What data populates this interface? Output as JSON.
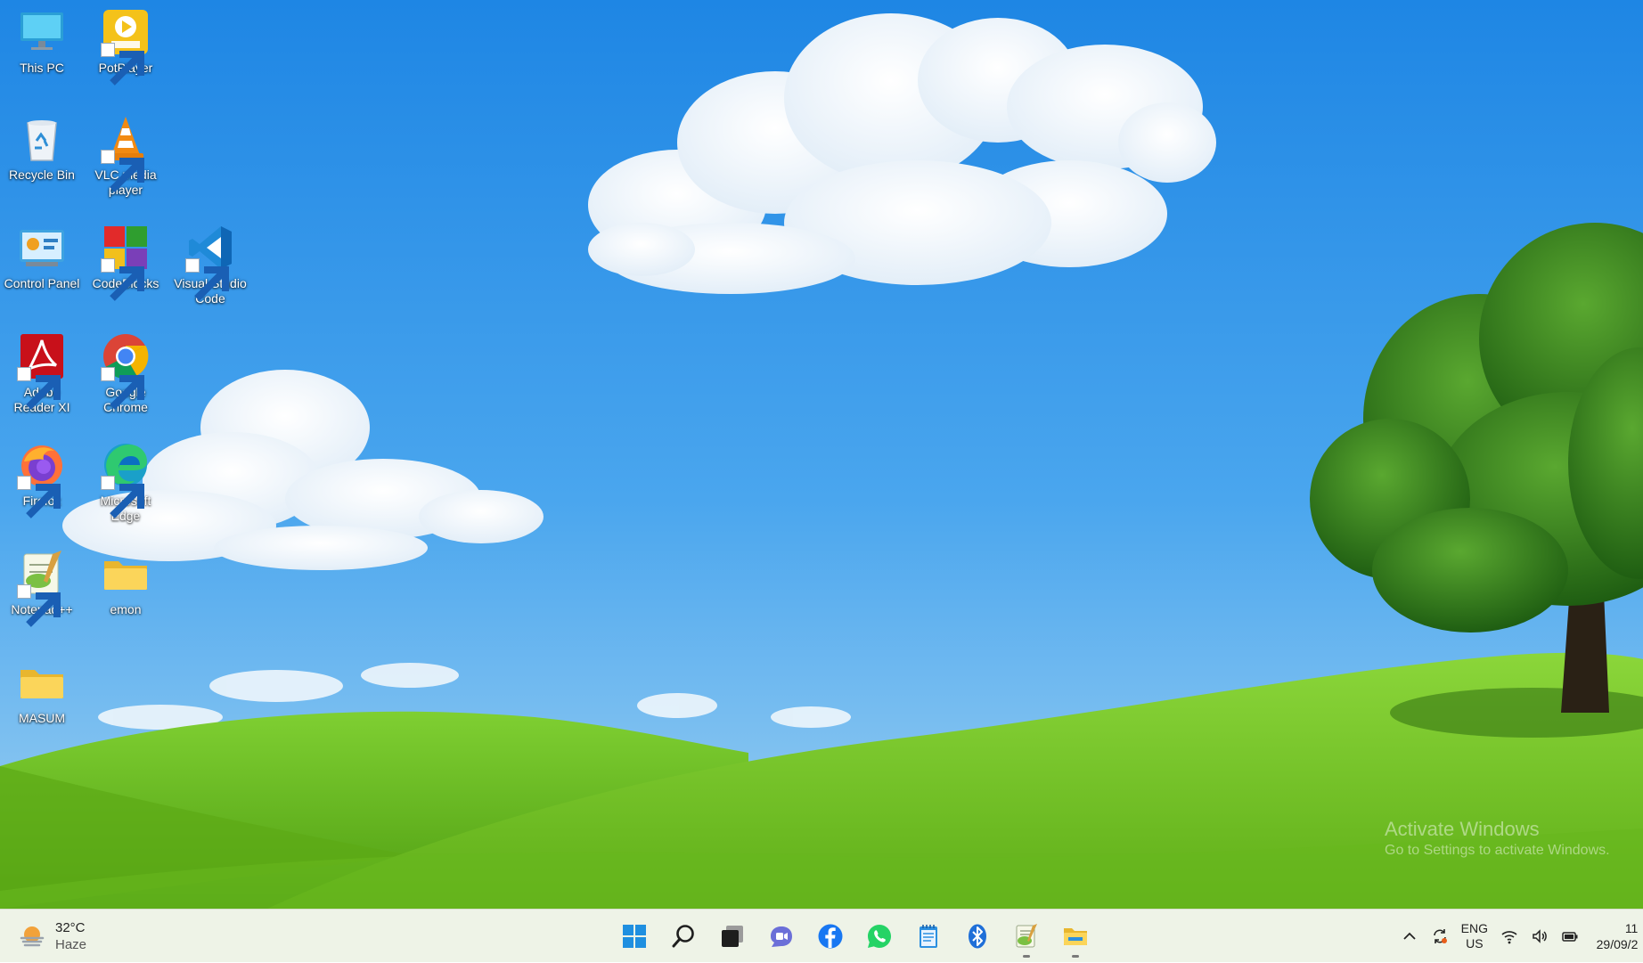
{
  "desktop": {
    "icons": [
      {
        "label": "This PC",
        "icon": "this-pc-icon"
      },
      {
        "label": "PotPlayer",
        "icon": "potplayer-icon"
      },
      {
        "label": "Recycle Bin",
        "icon": "recycle-bin-icon"
      },
      {
        "label": "VLC media player",
        "icon": "vlc-icon"
      },
      {
        "label": "Control Panel",
        "icon": "control-panel-icon"
      },
      {
        "label": "CodeBlocks",
        "icon": "codeblocks-icon"
      },
      {
        "label": "Visual Studio Code",
        "icon": "vscode-icon"
      },
      {
        "label": "Adobe Reader XI",
        "icon": "adobe-reader-icon"
      },
      {
        "label": "Google Chrome",
        "icon": "chrome-icon"
      },
      {
        "label": "Firefox",
        "icon": "firefox-icon"
      },
      {
        "label": "Microsoft Edge",
        "icon": "edge-icon"
      },
      {
        "label": "Notepad++",
        "icon": "notepad-plus-plus-icon"
      },
      {
        "label": "emon",
        "icon": "folder-icon"
      },
      {
        "label": "MASUM",
        "icon": "folder-icon"
      }
    ],
    "watermark": {
      "line1": "Activate Windows",
      "line2": "Go to Settings to activate Windows."
    }
  },
  "taskbar": {
    "weather": {
      "temperature": "32°C",
      "condition": "Haze",
      "icon": "weather-haze-icon"
    },
    "apps": [
      {
        "name": "Start",
        "icon": "windows-start-icon"
      },
      {
        "name": "Search",
        "icon": "search-icon"
      },
      {
        "name": "Task View",
        "icon": "task-view-icon"
      },
      {
        "name": "Teams Chat",
        "icon": "teams-chat-icon"
      },
      {
        "name": "Facebook",
        "icon": "facebook-icon"
      },
      {
        "name": "WhatsApp",
        "icon": "whatsapp-icon"
      },
      {
        "name": "Notepad",
        "icon": "notepad-icon"
      },
      {
        "name": "Bluetooth",
        "icon": "bluetooth-icon"
      },
      {
        "name": "Notepad++",
        "icon": "notepad-plus-plus-icon",
        "running": true
      },
      {
        "name": "File Explorer",
        "icon": "file-explorer-icon",
        "running": true
      }
    ],
    "tray": {
      "language_line1": "ENG",
      "language_line2": "US",
      "time": "11",
      "date": "29/09/2"
    }
  },
  "colors": {
    "sky_top": "#1f87e3",
    "sky_bottom": "#7ec2f0",
    "grass": "#6cc21a",
    "taskbar": "#eef3e7"
  }
}
